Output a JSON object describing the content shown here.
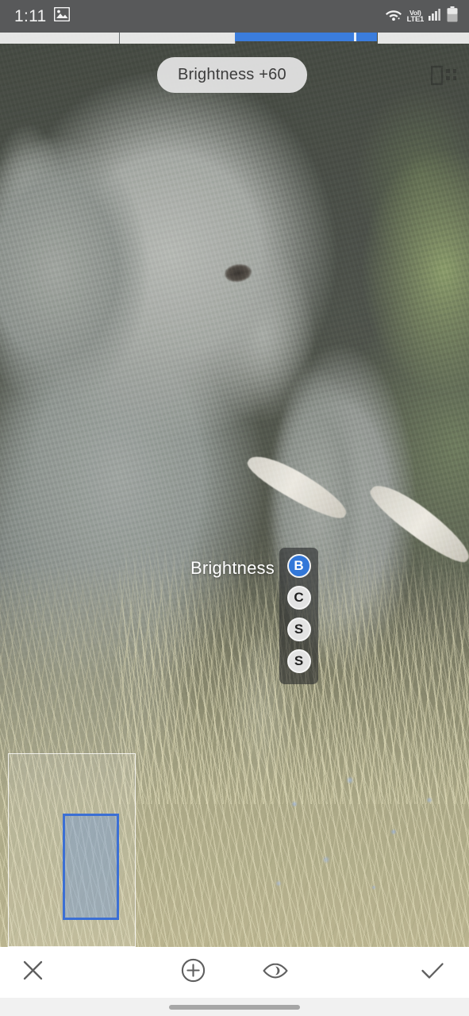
{
  "status_bar": {
    "time": "1:11",
    "notification_icon": "photo-icon",
    "wifi_icon": "wifi-icon",
    "volte_line1": "VoI)",
    "volte_line2": "LTE1",
    "signal_icon": "signal-bars-icon",
    "battery_icon": "battery-icon",
    "background_color": "#58595a"
  },
  "tab_strip": {
    "progress_color": "#3b7ddd",
    "track_color": "#fcfcfc"
  },
  "photo": {
    "subject": "elephant-photo",
    "alt": "Elephant standing in dry grass"
  },
  "toast": {
    "label": "Brightness +60"
  },
  "compare": {
    "icon": "split-compare-icon"
  },
  "adjustment": {
    "label": "Brightness",
    "active_color": "#3277d8",
    "inactive_color": "#e3e3e3",
    "buttons": [
      {
        "letter": "B",
        "name": "brightness",
        "active": true
      },
      {
        "letter": "C",
        "name": "contrast",
        "active": false
      },
      {
        "letter": "S",
        "name": "saturation",
        "active": false
      },
      {
        "letter": "S",
        "name": "sharpness",
        "active": false
      }
    ]
  },
  "selection": {
    "outer_border_color": "#ffffff",
    "inner_border_color": "#3b6fd4",
    "inner_fill_color": "#6e96d7"
  },
  "toolbar": {
    "close_icon": "close-x-icon",
    "add_icon": "add-circle-icon",
    "preview_icon": "eye-icon",
    "done_icon": "check-icon"
  },
  "nav_bar": {
    "home_indicator": "home-indicator-bar"
  }
}
